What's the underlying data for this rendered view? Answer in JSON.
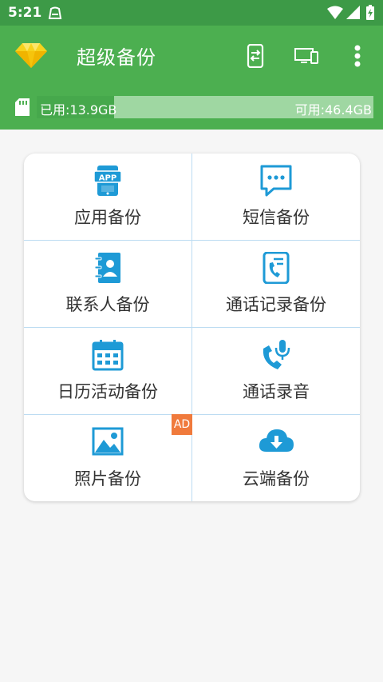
{
  "status_bar": {
    "time": "5:21"
  },
  "app_bar": {
    "title": "超级备份",
    "icons": [
      "diamond-logo-icon",
      "phone-transfer-icon",
      "devices-icon",
      "more-vertical-icon"
    ]
  },
  "storage": {
    "used_label": "已用:13.9GB",
    "free_label": "可用:46.4GB",
    "used_fraction": 0.23
  },
  "grid": {
    "items": [
      {
        "label": "应用备份",
        "icon": "app-icon"
      },
      {
        "label": "短信备份",
        "icon": "sms-icon"
      },
      {
        "label": "联系人备份",
        "icon": "contacts-icon"
      },
      {
        "label": "通话记录备份",
        "icon": "call-log-icon"
      },
      {
        "label": "日历活动备份",
        "icon": "calendar-icon"
      },
      {
        "label": "通话录音",
        "icon": "call-recording-icon"
      },
      {
        "label": "照片备份",
        "icon": "photo-icon",
        "badge": "AD"
      },
      {
        "label": "云端备份",
        "icon": "cloud-download-icon"
      }
    ]
  },
  "colors": {
    "status_bar": "#3d9a47",
    "app_bar": "#4caf50",
    "icon_blue": "#1e9ad6",
    "ad_badge": "#f07a3c"
  }
}
